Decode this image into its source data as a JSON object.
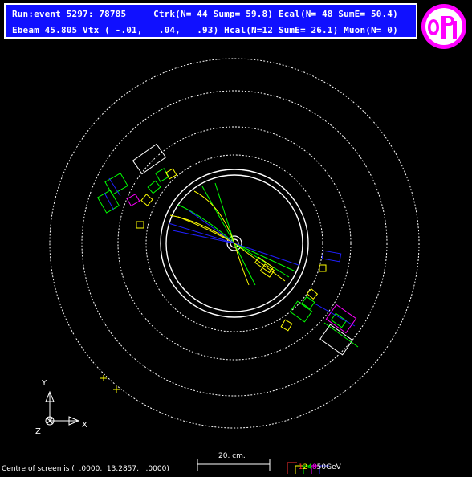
{
  "header": {
    "line1": "Run:event 5297: 78785     Ctrk(N= 44 Sump= 59.8) Ecal(N= 48 SumE= 50.4)",
    "line2": "Ebeam 45.805 Vtx ( -.01,   .04,   .93) Hcal(N=12 SumE= 26.1) Muon(N= 0)"
  },
  "logo": {
    "name": "opal-logo-icon",
    "colors": {
      "ring": "#ff00ff",
      "fill": "#ffffff"
    }
  },
  "axes": {
    "y_label": "Y",
    "x_label": "X",
    "z_label": "Z"
  },
  "footer": {
    "centre_text": "Centre of screen is (  .0000,  13.2857,   .0000)",
    "scale_label": "20. cm.",
    "energy_scale": {
      "digits": [
        "1",
        "2",
        "4",
        "8",
        "50"
      ],
      "unit": "GeV",
      "colors": [
        "#ff3030",
        "#ffff00",
        "#00ff00",
        "#ff00ff",
        "#3030ff"
      ]
    }
  },
  "colors": {
    "background": "#000000",
    "header_bg": "#1010ff",
    "track_green": "#00ff00",
    "track_yellow": "#ffff00",
    "track_blue": "#2020ff",
    "ecal_yellow": "#ffff00",
    "hcal_magenta": "#ff00ff"
  }
}
